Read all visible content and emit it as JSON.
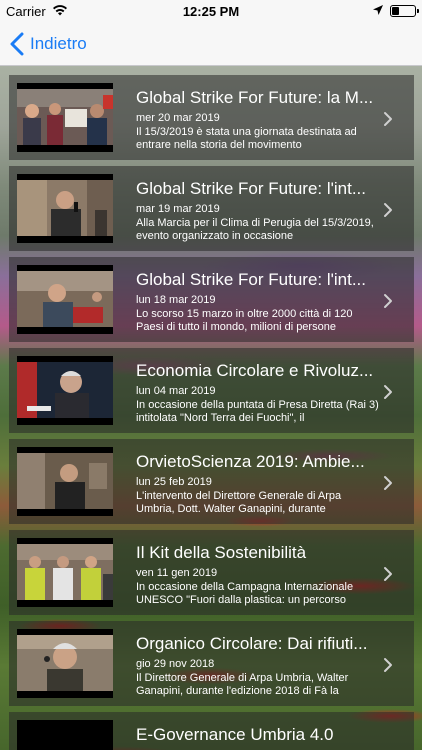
{
  "status_bar": {
    "carrier": "Carrier",
    "time": "12:25 PM"
  },
  "nav": {
    "back_label": "Indietro",
    "accent_color": "#1a7cf5"
  },
  "items": [
    {
      "title": "Global Strike For Future: la M...",
      "date": "mer 20 mar 2019",
      "description": "Il 15/3/2019 è stata una giornata destinata ad entrare nella storia del movimento"
    },
    {
      "title": "Global Strike For Future: l'int...",
      "date": "mar 19 mar 2019",
      "description": "Alla Marcia per il Clima di Perugia del 15/3/2019, evento organizzato in occasione"
    },
    {
      "title": "Global Strike For Future: l'int...",
      "date": "lun 18 mar 2019",
      "description": "Lo scorso 15 marzo in oltre 2000 città di 120 Paesi di tutto il mondo, milioni di persone"
    },
    {
      "title": "Economia Circolare e Rivoluz...",
      "date": "lun 04 mar 2019",
      "description": "In occasione della puntata di Presa Diretta (Rai 3) intitolata \"Nord Terra dei Fuochi\", il"
    },
    {
      "title": "OrvietoScienza 2019: Ambie...",
      "date": "lun 25 feb 2019",
      "description": "L'intervento del Direttore Generale di Arpa Umbria, Dott. Walter Ganapini, durante"
    },
    {
      "title": "Il Kit della Sostenibilità",
      "date": "ven 11 gen 2019",
      "description": "In occasione della Campagna Internazionale UNESCO \"Fuori dalla plastica: un percorso"
    },
    {
      "title": "Organico Circolare: Dai rifiuti...",
      "date": "gio 29 nov 2018",
      "description": "Il Direttore Generale di Arpa Umbria, Walter Ganapini, durante l'edizione 2018 di Fà la"
    },
    {
      "title": "E-Governance Umbria 4.0",
      "date": "",
      "description": ""
    }
  ]
}
